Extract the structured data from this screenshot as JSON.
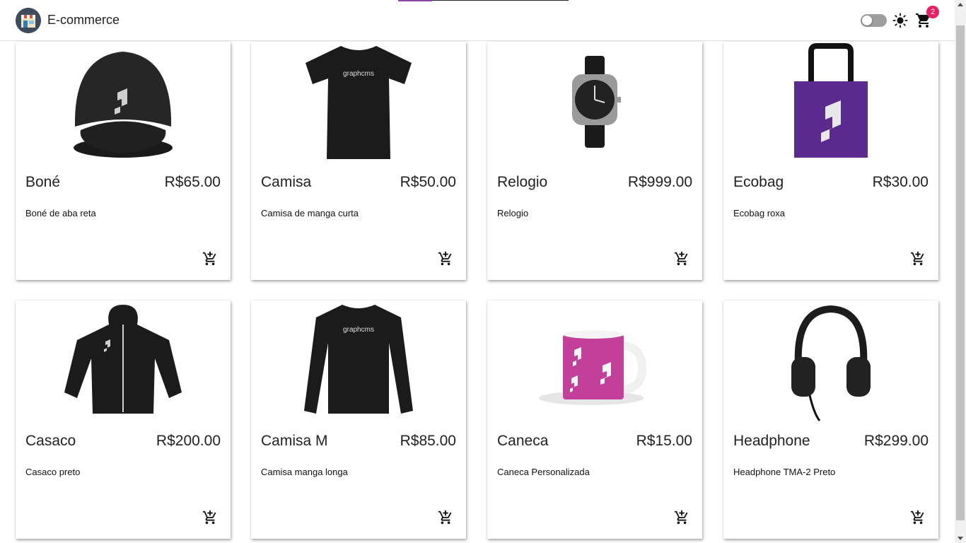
{
  "app": {
    "title": "E-commerce",
    "cart_count": "2"
  },
  "loading": {
    "progress": 0.2
  },
  "colors": {
    "accent": "#8e44ad",
    "badge": "#e91e63",
    "purple_bag": "#5b2a8f",
    "mug": "#c2409a"
  },
  "products": [
    {
      "name": "Boné",
      "price": "R$65.00",
      "description": "Boné de aba reta",
      "icon": "cap-image"
    },
    {
      "name": "Camisa",
      "price": "R$50.00",
      "description": "Camisa de manga curta",
      "icon": "tshirt-image"
    },
    {
      "name": "Relogio",
      "price": "R$999.00",
      "description": "Relogio",
      "icon": "watch-image"
    },
    {
      "name": "Ecobag",
      "price": "R$30.00",
      "description": "Ecobag roxa",
      "icon": "tote-bag-image"
    },
    {
      "name": "Casaco",
      "price": "R$200.00",
      "description": "Casaco preto",
      "icon": "hoodie-image"
    },
    {
      "name": "Camisa M",
      "price": "R$85.00",
      "description": "Camisa manga longa",
      "icon": "long-sleeve-image"
    },
    {
      "name": "Caneca",
      "price": "R$15.00",
      "description": "Caneca Personalizada",
      "icon": "mug-image"
    },
    {
      "name": "Headphone",
      "price": "R$299.00",
      "description": "Headphone TMA-2 Preto",
      "icon": "headphone-image"
    }
  ]
}
